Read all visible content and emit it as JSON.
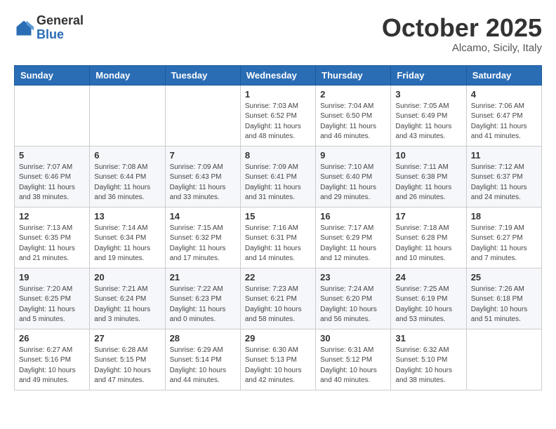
{
  "header": {
    "logo_general": "General",
    "logo_blue": "Blue",
    "month": "October 2025",
    "location": "Alcamo, Sicily, Italy"
  },
  "days_of_week": [
    "Sunday",
    "Monday",
    "Tuesday",
    "Wednesday",
    "Thursday",
    "Friday",
    "Saturday"
  ],
  "weeks": [
    [
      {
        "day": "",
        "info": ""
      },
      {
        "day": "",
        "info": ""
      },
      {
        "day": "",
        "info": ""
      },
      {
        "day": "1",
        "info": "Sunrise: 7:03 AM\nSunset: 6:52 PM\nDaylight: 11 hours\nand 48 minutes."
      },
      {
        "day": "2",
        "info": "Sunrise: 7:04 AM\nSunset: 6:50 PM\nDaylight: 11 hours\nand 46 minutes."
      },
      {
        "day": "3",
        "info": "Sunrise: 7:05 AM\nSunset: 6:49 PM\nDaylight: 11 hours\nand 43 minutes."
      },
      {
        "day": "4",
        "info": "Sunrise: 7:06 AM\nSunset: 6:47 PM\nDaylight: 11 hours\nand 41 minutes."
      }
    ],
    [
      {
        "day": "5",
        "info": "Sunrise: 7:07 AM\nSunset: 6:46 PM\nDaylight: 11 hours\nand 38 minutes."
      },
      {
        "day": "6",
        "info": "Sunrise: 7:08 AM\nSunset: 6:44 PM\nDaylight: 11 hours\nand 36 minutes."
      },
      {
        "day": "7",
        "info": "Sunrise: 7:09 AM\nSunset: 6:43 PM\nDaylight: 11 hours\nand 33 minutes."
      },
      {
        "day": "8",
        "info": "Sunrise: 7:09 AM\nSunset: 6:41 PM\nDaylight: 11 hours\nand 31 minutes."
      },
      {
        "day": "9",
        "info": "Sunrise: 7:10 AM\nSunset: 6:40 PM\nDaylight: 11 hours\nand 29 minutes."
      },
      {
        "day": "10",
        "info": "Sunrise: 7:11 AM\nSunset: 6:38 PM\nDaylight: 11 hours\nand 26 minutes."
      },
      {
        "day": "11",
        "info": "Sunrise: 7:12 AM\nSunset: 6:37 PM\nDaylight: 11 hours\nand 24 minutes."
      }
    ],
    [
      {
        "day": "12",
        "info": "Sunrise: 7:13 AM\nSunset: 6:35 PM\nDaylight: 11 hours\nand 21 minutes."
      },
      {
        "day": "13",
        "info": "Sunrise: 7:14 AM\nSunset: 6:34 PM\nDaylight: 11 hours\nand 19 minutes."
      },
      {
        "day": "14",
        "info": "Sunrise: 7:15 AM\nSunset: 6:32 PM\nDaylight: 11 hours\nand 17 minutes."
      },
      {
        "day": "15",
        "info": "Sunrise: 7:16 AM\nSunset: 6:31 PM\nDaylight: 11 hours\nand 14 minutes."
      },
      {
        "day": "16",
        "info": "Sunrise: 7:17 AM\nSunset: 6:29 PM\nDaylight: 11 hours\nand 12 minutes."
      },
      {
        "day": "17",
        "info": "Sunrise: 7:18 AM\nSunset: 6:28 PM\nDaylight: 11 hours\nand 10 minutes."
      },
      {
        "day": "18",
        "info": "Sunrise: 7:19 AM\nSunset: 6:27 PM\nDaylight: 11 hours\nand 7 minutes."
      }
    ],
    [
      {
        "day": "19",
        "info": "Sunrise: 7:20 AM\nSunset: 6:25 PM\nDaylight: 11 hours\nand 5 minutes."
      },
      {
        "day": "20",
        "info": "Sunrise: 7:21 AM\nSunset: 6:24 PM\nDaylight: 11 hours\nand 3 minutes."
      },
      {
        "day": "21",
        "info": "Sunrise: 7:22 AM\nSunset: 6:23 PM\nDaylight: 11 hours\nand 0 minutes."
      },
      {
        "day": "22",
        "info": "Sunrise: 7:23 AM\nSunset: 6:21 PM\nDaylight: 10 hours\nand 58 minutes."
      },
      {
        "day": "23",
        "info": "Sunrise: 7:24 AM\nSunset: 6:20 PM\nDaylight: 10 hours\nand 56 minutes."
      },
      {
        "day": "24",
        "info": "Sunrise: 7:25 AM\nSunset: 6:19 PM\nDaylight: 10 hours\nand 53 minutes."
      },
      {
        "day": "25",
        "info": "Sunrise: 7:26 AM\nSunset: 6:18 PM\nDaylight: 10 hours\nand 51 minutes."
      }
    ],
    [
      {
        "day": "26",
        "info": "Sunrise: 6:27 AM\nSunset: 5:16 PM\nDaylight: 10 hours\nand 49 minutes."
      },
      {
        "day": "27",
        "info": "Sunrise: 6:28 AM\nSunset: 5:15 PM\nDaylight: 10 hours\nand 47 minutes."
      },
      {
        "day": "28",
        "info": "Sunrise: 6:29 AM\nSunset: 5:14 PM\nDaylight: 10 hours\nand 44 minutes."
      },
      {
        "day": "29",
        "info": "Sunrise: 6:30 AM\nSunset: 5:13 PM\nDaylight: 10 hours\nand 42 minutes."
      },
      {
        "day": "30",
        "info": "Sunrise: 6:31 AM\nSunset: 5:12 PM\nDaylight: 10 hours\nand 40 minutes."
      },
      {
        "day": "31",
        "info": "Sunrise: 6:32 AM\nSunset: 5:10 PM\nDaylight: 10 hours\nand 38 minutes."
      },
      {
        "day": "",
        "info": ""
      }
    ]
  ]
}
